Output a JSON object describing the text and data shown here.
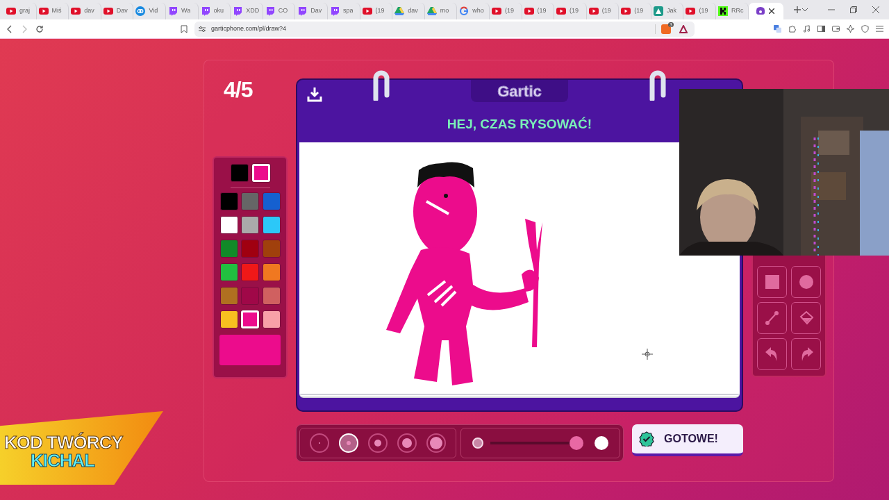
{
  "browser": {
    "tabs": [
      {
        "label": "graj",
        "kind": "youtube",
        "selected": false
      },
      {
        "label": "Miś",
        "kind": "youtube",
        "selected": false
      },
      {
        "label": "dav",
        "kind": "youtube",
        "selected": false
      },
      {
        "label": "Dav",
        "kind": "youtube",
        "selected": false
      },
      {
        "label": "Vid",
        "kind": "link",
        "selected": false
      },
      {
        "label": "Wa",
        "kind": "twitch",
        "selected": false
      },
      {
        "label": "oku",
        "kind": "twitch",
        "selected": false
      },
      {
        "label": "XDD",
        "kind": "twitch",
        "selected": false
      },
      {
        "label": "CO",
        "kind": "twitch",
        "selected": false
      },
      {
        "label": "Dav",
        "kind": "twitch",
        "selected": false
      },
      {
        "label": "spa",
        "kind": "twitch",
        "selected": false
      },
      {
        "label": "(19",
        "kind": "youtube",
        "selected": false
      },
      {
        "label": "dav",
        "kind": "drive",
        "selected": false
      },
      {
        "label": "mo",
        "kind": "drive",
        "selected": false
      },
      {
        "label": "who",
        "kind": "google",
        "selected": false
      },
      {
        "label": "(19",
        "kind": "youtube",
        "selected": false
      },
      {
        "label": "(19",
        "kind": "youtube",
        "selected": false
      },
      {
        "label": "(19",
        "kind": "youtube",
        "selected": false
      },
      {
        "label": "(19",
        "kind": "youtube",
        "selected": false
      },
      {
        "label": "(19",
        "kind": "youtube",
        "selected": false
      },
      {
        "label": "Jak",
        "kind": "app",
        "selected": false
      },
      {
        "label": "(19",
        "kind": "youtube",
        "selected": false
      },
      {
        "label": "RRc",
        "kind": "kick",
        "selected": false
      },
      {
        "kind": "phone",
        "selected": true
      }
    ],
    "url": "garticphone.com/pl/draw?4",
    "extension_badge": "3"
  },
  "game": {
    "counter": "4/5",
    "brand": "Gartic",
    "prompt": "HEJ, CZAS RYSOWAĆ!",
    "recent_colors": [
      {
        "color": "#000000",
        "selected": false
      },
      {
        "color": "#ec0c8c",
        "selected": true
      }
    ],
    "palette": [
      {
        "color": "#000000",
        "selected": false
      },
      {
        "color": "#666666",
        "selected": false
      },
      {
        "color": "#1560d0",
        "selected": false
      },
      {
        "color": "#ffffff",
        "selected": false
      },
      {
        "color": "#aaaaaa",
        "selected": false
      },
      {
        "color": "#2cc8f8",
        "selected": false
      },
      {
        "color": "#118a28",
        "selected": false
      },
      {
        "color": "#a00010",
        "selected": false
      },
      {
        "color": "#a0400c",
        "selected": false
      },
      {
        "color": "#22c040",
        "selected": false
      },
      {
        "color": "#f01818",
        "selected": false
      },
      {
        "color": "#f07820",
        "selected": false
      },
      {
        "color": "#b07020",
        "selected": false
      },
      {
        "color": "#a00848",
        "selected": false
      },
      {
        "color": "#d06060",
        "selected": false
      },
      {
        "color": "#f8c020",
        "selected": false
      },
      {
        "color": "#ec0c8c",
        "selected": true
      },
      {
        "color": "#f8a0a8",
        "selected": false
      }
    ],
    "current_color": {
      "color": "#ec0c8c"
    },
    "tools": [
      {
        "kind": "square"
      },
      {
        "kind": "circle"
      },
      {
        "kind": "line"
      },
      {
        "kind": "bucket"
      },
      {
        "kind": "undo"
      },
      {
        "kind": "redo"
      }
    ],
    "brush_sizes": [
      {
        "selected": false
      },
      {
        "selected": true
      },
      {
        "selected": false
      },
      {
        "selected": false
      },
      {
        "selected": false
      }
    ],
    "opacity": {
      "level": 1
    },
    "done_button": "GOTOWE!"
  },
  "overlay": {
    "creator_code_label": "KOD TWÓRCY",
    "creator_code": "KICHAL"
  }
}
